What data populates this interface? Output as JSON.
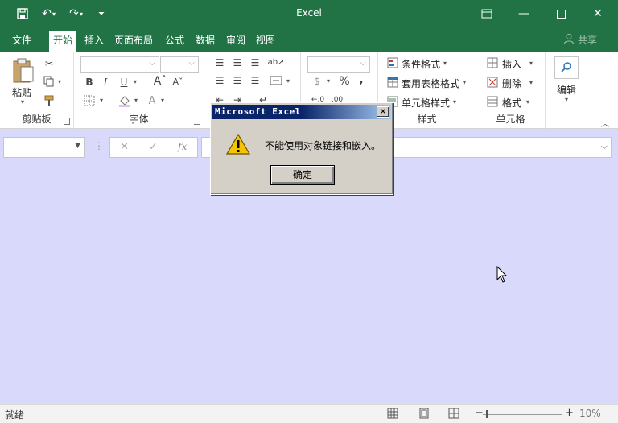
{
  "app": {
    "title": "Excel"
  },
  "tabs": [
    "文件",
    "开始",
    "插入",
    "页面布局",
    "公式",
    "数据",
    "审阅",
    "视图"
  ],
  "share_label": "共享",
  "ribbon": {
    "clipboard": {
      "paste_label": "粘贴",
      "group_label": "剪贴板"
    },
    "font": {
      "group_label": "字体",
      "bold": "B",
      "italic": "I",
      "underline": "U"
    },
    "number": {
      "percent": "%",
      "comma": ","
    },
    "styles": {
      "conditional": "条件格式",
      "table_format": "套用表格格式",
      "cell_style": "单元格样式",
      "group_label": "样式"
    },
    "cells": {
      "insert": "插入",
      "delete": "删除",
      "format": "格式",
      "group_label": "单元格"
    },
    "editing": {
      "label": "编辑"
    }
  },
  "formula": {
    "fx": "fx"
  },
  "status": {
    "ready": "就绪",
    "zoom": "10%"
  },
  "dialog": {
    "title": "Microsoft Excel",
    "message": "不能使用对象链接和嵌入。",
    "ok": "确定"
  },
  "colors": {
    "accent": "#217346",
    "workspace": "#d9d9fc"
  }
}
